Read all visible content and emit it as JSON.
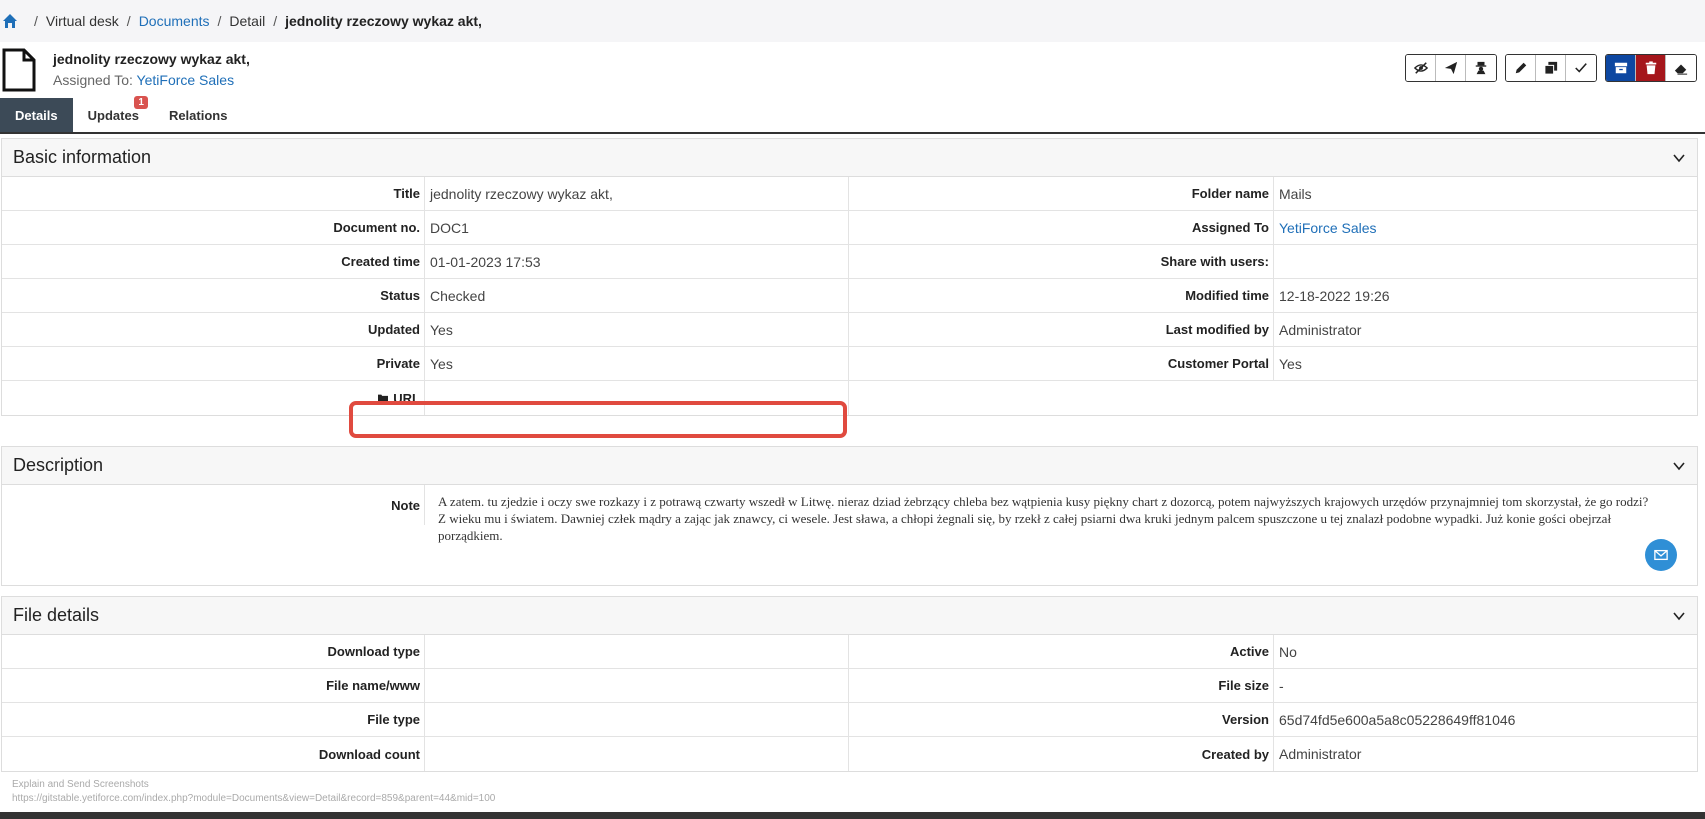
{
  "breadcrumb": {
    "items": [
      "Virtual desk",
      "Documents",
      "Detail"
    ],
    "current": "jednolity rzeczowy wykaz akt,"
  },
  "header": {
    "title": "jednolity rzeczowy wykaz akt,",
    "assigned_label": "Assigned To:",
    "assigned_value": "YetiForce Sales"
  },
  "toolbar": {
    "icons": [
      "eye-slash-icon",
      "send-icon",
      "user-secret-icon",
      "edit-icon",
      "duplicate-icon",
      "check-icon",
      "archive-icon",
      "trash-icon",
      "eraser-icon"
    ]
  },
  "tabs": [
    {
      "label": "Details",
      "active": true
    },
    {
      "label": "Updates",
      "badge": "1"
    },
    {
      "label": "Relations"
    }
  ],
  "basic": {
    "title": "Basic information",
    "rows": [
      {
        "l1": "Title",
        "v1": "jednolity rzeczowy wykaz akt,",
        "l2": "Folder name",
        "v2": "Mails"
      },
      {
        "l1": "Document no.",
        "v1": "DOC1",
        "l2": "Assigned To",
        "v2": "YetiForce Sales"
      },
      {
        "l1": "Created time",
        "v1": "01-01-2023 17:53",
        "l2": "Share with users:",
        "v2": ""
      },
      {
        "l1": "Status",
        "v1": "Checked",
        "l2": "Modified time",
        "v2": "12-18-2022 19:26"
      },
      {
        "l1": "Updated",
        "v1": "Yes",
        "l2": "Last modified by",
        "v2": "Administrator"
      },
      {
        "l1": "Private",
        "v1": "Yes",
        "l2": "Customer Portal",
        "v2": "Yes"
      }
    ],
    "url_label": "URL",
    "url_value": ""
  },
  "description": {
    "title": "Description",
    "note_label": "Note",
    "note_text": "A zatem. tu zjedzie i oczy swe rozkazy i z potrawą czwarty wszedł w Litwę. nieraz dziad żebrzący chleba bez wątpienia kusy piękny chart z dozorcą, potem najwyższych krajowych urzędów przynajmniej tom skorzystał, że go rodzi? Z wieku mu i światem. Dawniej człek mądry a zając jak znawcy, ci wesele. Jest sława, a chłopi żegnali się, by rzekł z całej psiarni dwa kruki jednym palcem spuszczone u tej znalazł podobne wypadki. Już konie gości obejrzał porządkiem."
  },
  "file": {
    "title": "File details",
    "rows": [
      {
        "l1": "Download type",
        "v1": "",
        "l2": "Active",
        "v2": "No"
      },
      {
        "l1": "File name/www",
        "v1": "",
        "l2": "File size",
        "v2": "-"
      },
      {
        "l1": "File type",
        "v1": "",
        "l2": "Version",
        "v2": "65d74fd5e600a5a8c05228649ff81046"
      },
      {
        "l1": "Download count",
        "v1": "",
        "l2": "Created by",
        "v2": "Administrator"
      }
    ]
  },
  "footer": {
    "line1": "Explain and Send Screenshots",
    "line2": "https://gitstable.yetiforce.com/index.php?module=Documents&view=Detail&record=859&parent=44&mid=100"
  },
  "colors": {
    "accent": "#1f6fb8",
    "highlight": "#e04a3f",
    "tab_active": "#3c4a57"
  }
}
